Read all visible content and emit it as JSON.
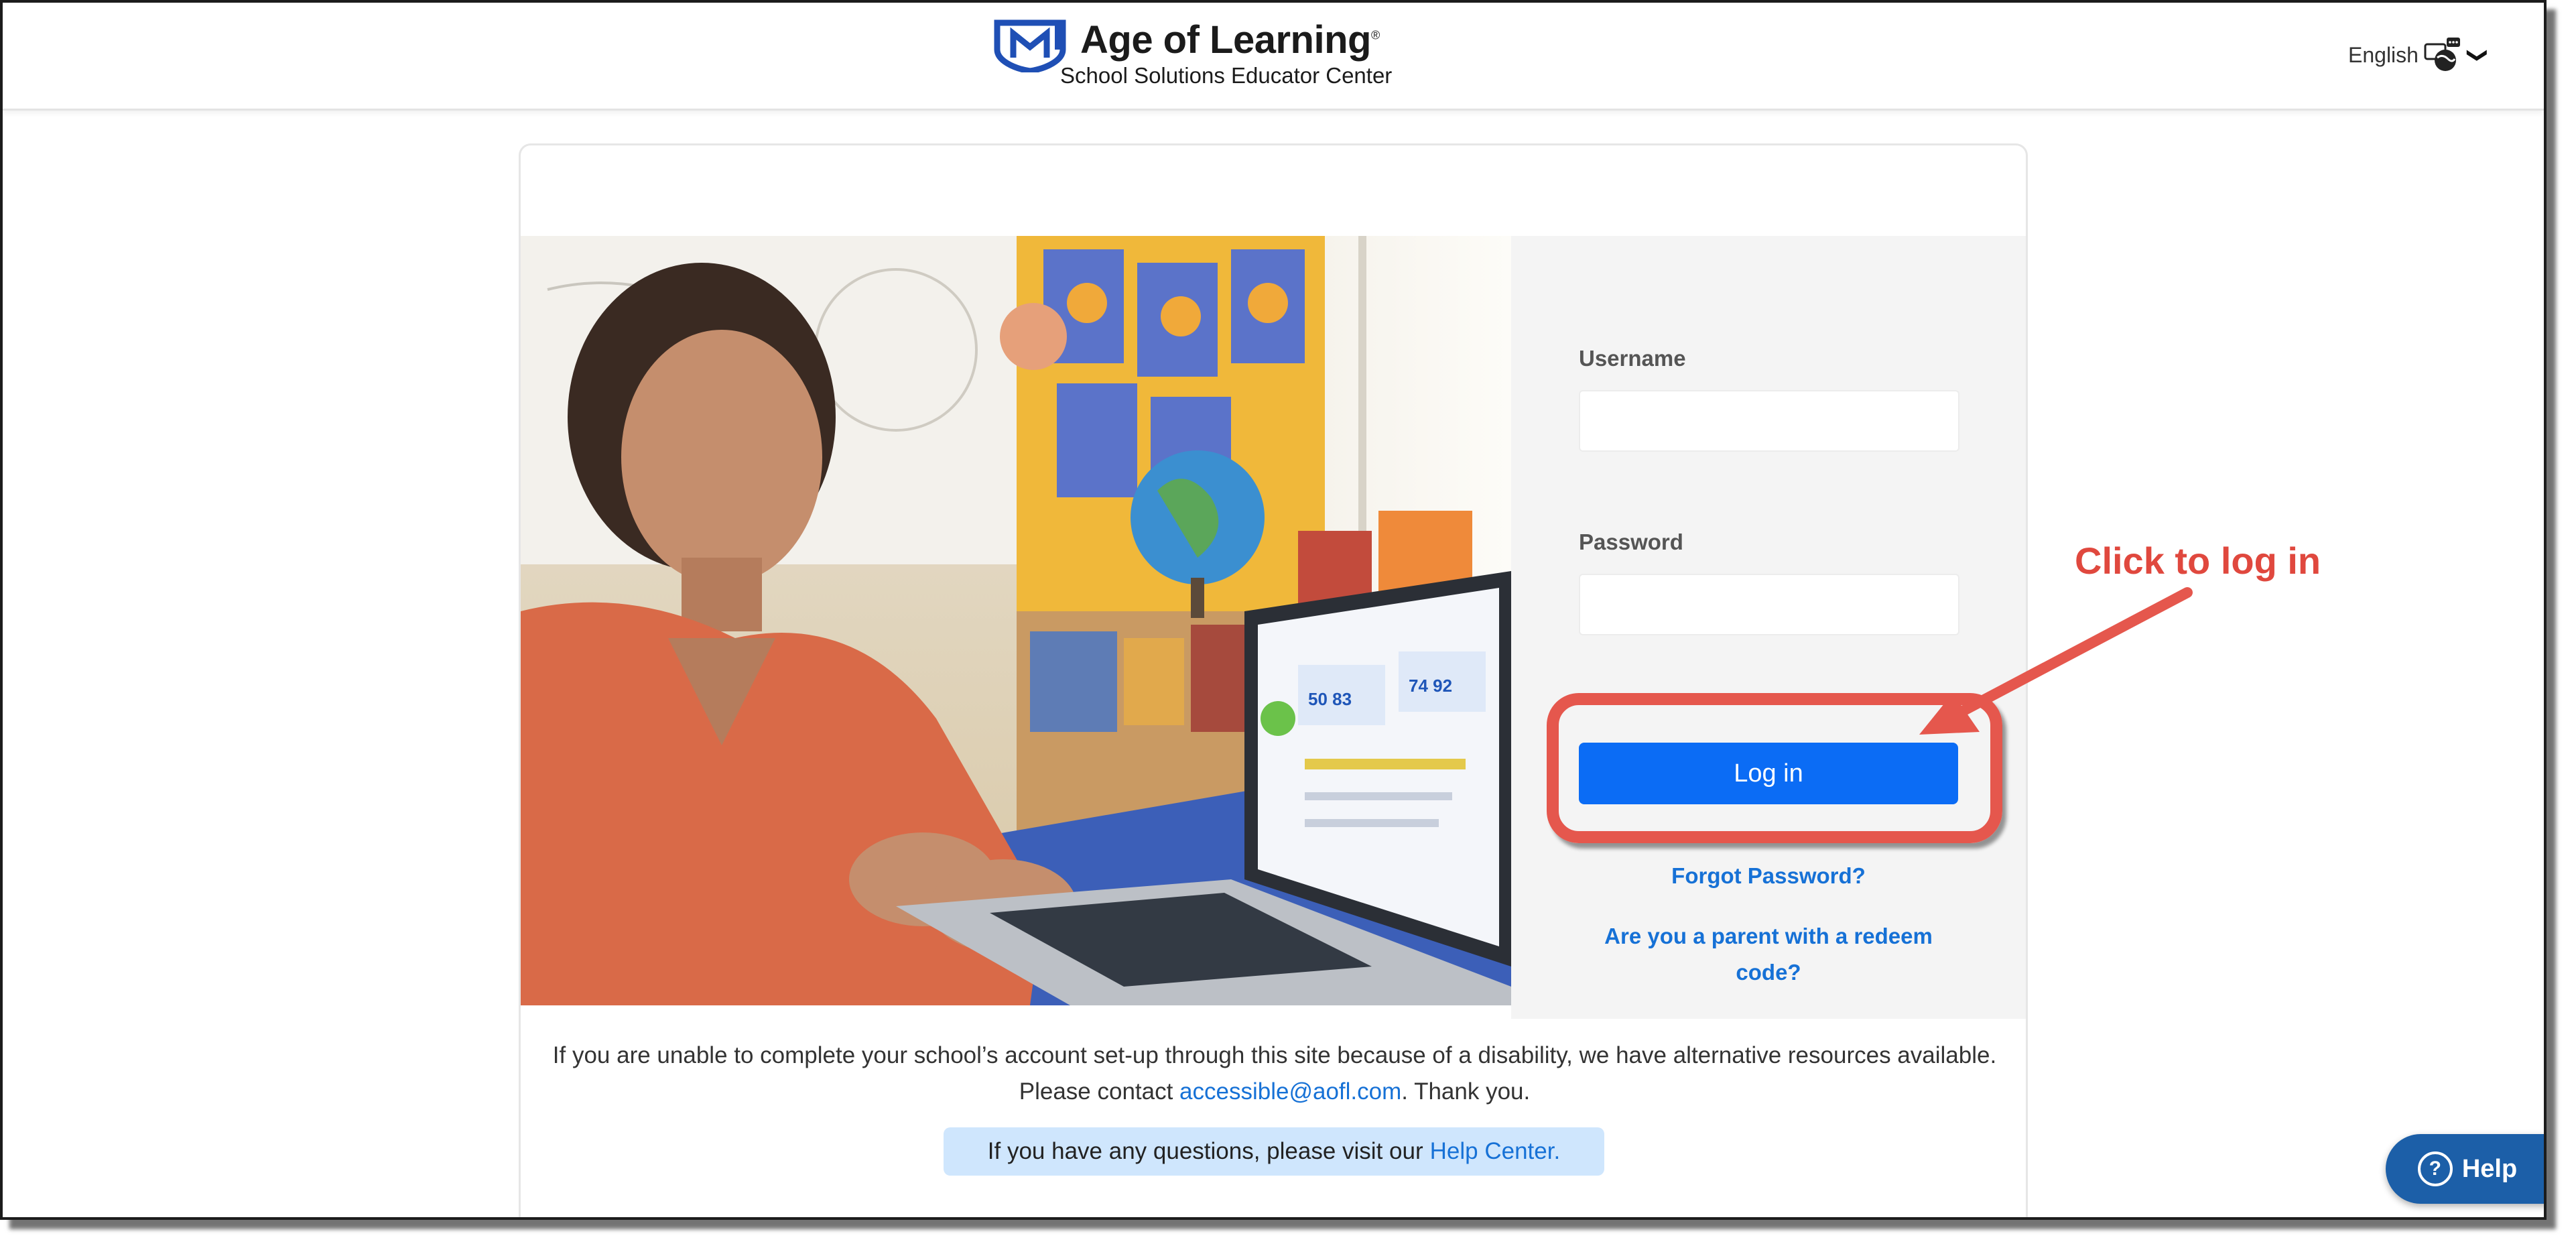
{
  "header": {
    "brand_name": "Age of Learning",
    "brand_mark": "®",
    "brand_subtitle": "School Solutions Educator Center",
    "language_label": "English",
    "language_icon": "globe-chat-icon",
    "language_chevron": "❯"
  },
  "login": {
    "username_label": "Username",
    "username_value": "",
    "password_label": "Password",
    "password_value": "",
    "login_button": "Log in",
    "forgot_password": "Forgot Password?",
    "parent_redeem_line1": "Are you a parent with a redeem",
    "parent_redeem_line2": "code?"
  },
  "annotation": {
    "text": "Click to log in",
    "color": "#e5574d"
  },
  "footer": {
    "notice_line1": "If you are unable to complete your school’s account set-up through this site because of a disability, we have alternative resources available.",
    "notice_line2_pre": "Please contact ",
    "notice_email": "accessible@aofl.com",
    "notice_line2_post": ". Thank you.",
    "help_banner_pre": "If you have any questions, please visit our",
    "help_banner_link": "Help Center."
  },
  "help_widget": {
    "label": "Help",
    "icon": "question-circle-icon"
  },
  "colors": {
    "primary_button": "#0b6cf5",
    "link": "#1671d6",
    "help_banner_bg": "#cfe6fd",
    "help_widget_bg": "#1c5fa8"
  }
}
